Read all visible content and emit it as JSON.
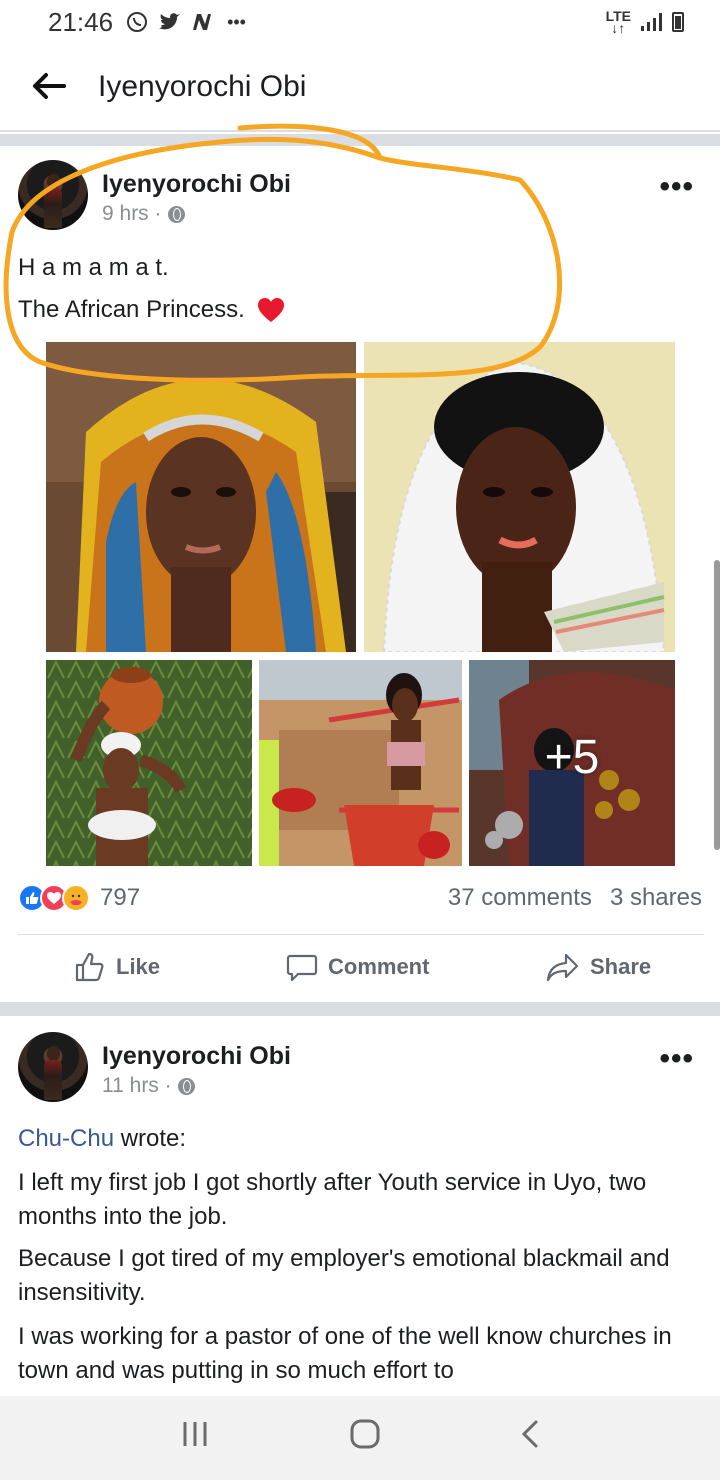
{
  "status_bar": {
    "time": "21:46",
    "notification_icons": [
      "whatsapp-icon",
      "twitter-icon",
      "news-icon"
    ],
    "more": "•••",
    "network": "LTE"
  },
  "header": {
    "title": "Iyenyorochi Obi"
  },
  "post1": {
    "author": "Iyenyorochi Obi",
    "time": "9 hrs ·",
    "line1": "H a m a m a t.",
    "line2": "The African Princess.",
    "more_photos": "+5",
    "reaction_count": "797",
    "comments": "37 comments",
    "shares": "3 shares",
    "actions": {
      "like": "Like",
      "comment": "Comment",
      "share": "Share"
    }
  },
  "post2": {
    "author": "Iyenyorochi Obi",
    "time": "11 hrs ·",
    "quoted_user": "Chu-Chu",
    "wrote": " wrote:",
    "para1": "I left my first job I got shortly after Youth service in Uyo, two months into the job.",
    "para2": "Because I got tired of my employer's emotional blackmail and insensitivity.",
    "para3": "I was working for a pastor of one of the well know churches in town and was putting in so much effort to"
  },
  "colors": {
    "annotation_circle": "#f5a623",
    "link": "#385898",
    "like_blue": "#1877f2",
    "love_red": "#f33e58"
  }
}
